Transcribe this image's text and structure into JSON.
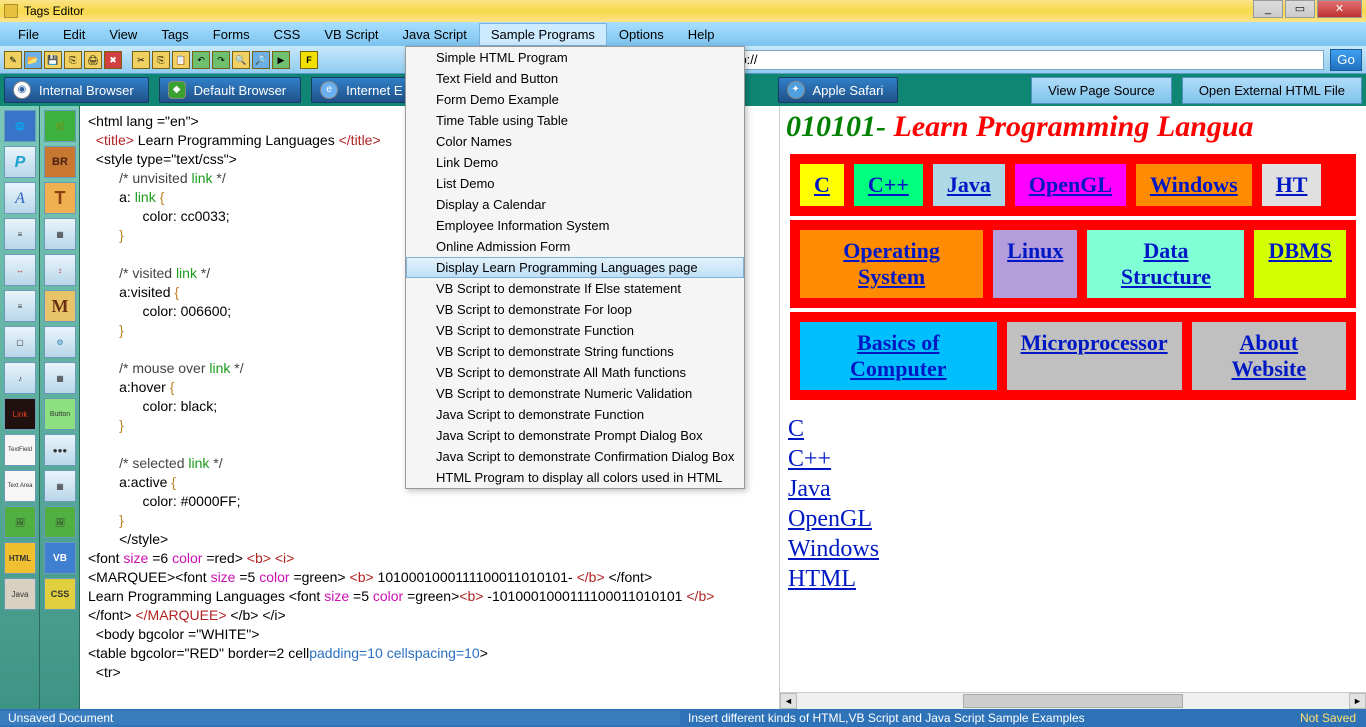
{
  "window": {
    "title": "Tags Editor"
  },
  "menubar": [
    "File",
    "Edit",
    "View",
    "Tags",
    "Forms",
    "CSS",
    "VB Script",
    "Java Script",
    "Sample Programs",
    "Options",
    "Help"
  ],
  "menubar_open_index": 8,
  "dropdown": {
    "items": [
      "Simple HTML Program",
      "Text Field and Button",
      "Form Demo Example",
      "Time Table using Table",
      "Color Names",
      "Link Demo",
      "List Demo",
      "Display a Calendar",
      "Employee Information System",
      "Online Admission Form",
      "Display Learn Programming Languages page",
      "VB Script to demonstrate If Else statement",
      "VB Script to demonstrate For loop",
      "VB Script to demonstrate Function",
      "VB Script to demonstrate String functions",
      "VB Script to demonstrate All Math functions",
      "VB Script to demonstrate Numeric Validation",
      "Java Script to demonstrate Function",
      "Java Script to demonstrate Prompt Dialog Box",
      "Java Script to demonstrate Confirmation Dialog Box",
      "HTML Program to display all colors used in HTML"
    ],
    "hover_index": 10
  },
  "address": {
    "label": ">",
    "value": "http://",
    "go": "Go"
  },
  "browser_tabs": {
    "internal": "Internal Browser",
    "default": "Default Browser",
    "ie": "Internet E",
    "safari": "Apple Safari",
    "view_source": "View Page Source",
    "open_file": "Open External HTML File"
  },
  "side_left": [
    "🌐",
    "🌿",
    "P",
    "BR",
    "A",
    "T",
    "≡",
    "▦",
    "↔",
    "↕",
    "≡",
    "M",
    "▢",
    "⚙",
    "♪",
    "▦",
    "Link",
    "Button",
    "TextField",
    "●●●",
    "Text Area",
    "▦",
    "🖼",
    "🖼",
    "HTML",
    "VB",
    "Java",
    "CSS"
  ],
  "editor": {
    "l1a": "<html lang =\"en\">",
    "l2a": "<title>",
    "l2b": " Learn Programming Languages ",
    "l2c": "</title>",
    "l3": "<style type=\"text/css\">",
    "c1": "/* unvisited ",
    "c1b": "link",
    "c1c": " */",
    "e1": "a: ",
    "e1b": "link",
    "e1c": " {",
    "e2": "color: cc0033;",
    "e3": "}",
    "c2": "/* visited ",
    "c2b": "link",
    "c2c": " */",
    "e4": "a:visited ",
    "e4b": "{",
    "e5": "color: 006600;",
    "e6": "}",
    "c3": "/* mouse over ",
    "c3b": "link",
    "c3c": " */",
    "e7": "a:hover ",
    "e7b": "{",
    "e8": "color: black;",
    "e9": "}",
    "c4": "/* selected ",
    "c4b": "link",
    "c4c": " */",
    "e10": "a:active ",
    "e10b": "{",
    "e11": "color: #0000FF;",
    "e12": "}",
    "e13": "</style>",
    "f1": "<font  ",
    "f1b": "size ",
    "f1c": "=6 ",
    "f1d": "color ",
    "f1e": "=red> ",
    "f1f": "<b> <i>",
    "m1": "<MARQUEE><font ",
    "m1b": "size ",
    "m1c": "=5 ",
    "m1d": "color ",
    "m1e": "=green> ",
    "m1f": "<b>",
    "m1g": " 1010001000111100011010101- ",
    "m1h": "</b>",
    "m1i": " </font>",
    "m2": "Learn Programming Languages <font ",
    "m2b": "size ",
    "m2c": "=5 ",
    "m2d": "color ",
    "m2e": "=green>",
    "m2f": "<b>",
    "m2g": " -1010001000111100011010101 ",
    "m2h": "</b>",
    "m3": "</font> ",
    "m3b": "</MARQUEE>",
    "m3c": " </b> </i>",
    "b1": "<body bgcolor =\"WHITE\">",
    "t1": "<table bgcolor=\"RED\" border=2 cell",
    "t1b": "padding=10 cellspacing=10",
    ">": ">",
    "tr": "<tr>"
  },
  "preview": {
    "marquee_prefix": "010101-",
    "marquee_main": " Learn Programming Langua",
    "row1": [
      {
        "label": "C",
        "bg": "#ffff00"
      },
      {
        "label": "C++",
        "bg": "#00ff7f"
      },
      {
        "label": "Java",
        "bg": "#add8e6"
      },
      {
        "label": "OpenGL",
        "bg": "#ff00ff"
      },
      {
        "label": "Windows",
        "bg": "#ff8c00"
      },
      {
        "label": "HT",
        "bg": "#e0e0e0"
      }
    ],
    "row2": [
      {
        "label": "Operating System",
        "bg": "#ff8c00"
      },
      {
        "label": "Linux",
        "bg": "#b39ddb"
      },
      {
        "label": "Data Structure",
        "bg": "#80ffd4"
      },
      {
        "label": "DBMS",
        "bg": "#d4ff00"
      }
    ],
    "row3": [
      {
        "label": "Basics of Computer",
        "bg": "#00bfff"
      },
      {
        "label": "Microprocessor",
        "bg": "#c0c0c0"
      },
      {
        "label": "About Website",
        "bg": "#c0c0c0"
      }
    ],
    "links": [
      "C",
      "C++",
      "Java",
      "OpenGL",
      "Windows",
      "HTML"
    ]
  },
  "status": {
    "left": "Unsaved Document",
    "mid": "Insert different kinds of HTML,VB Script and Java Script Sample Examples",
    "right": "Not Saved"
  }
}
